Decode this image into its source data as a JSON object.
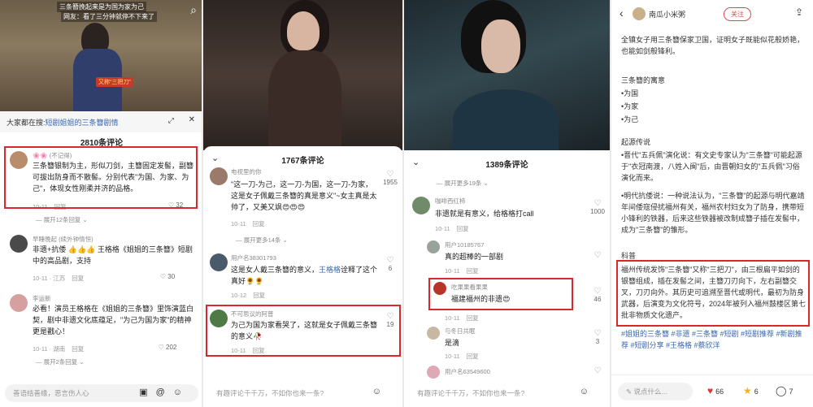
{
  "panel1": {
    "video_caption_top": "三条簪挽起来是为国为家为己",
    "video_caption_2": "网友：看了三分钟就停不下来了",
    "video_badge": "又称“三把刀”",
    "search_label": "大家都在搜:",
    "search_keyword": "短剧姐姐的三条簪剧情",
    "count": "2810条评论",
    "comments": [
      {
        "user": "🌸🌸 (不记得)",
        "text": "三条簪银制为主，形似刀剑，主簪固定发髻，副簪可拔出防身而不散髻。分别代表\"为国、为家、为己\"，体现女性刚柔并济的品格。",
        "meta": "10-11",
        "reply": "回复",
        "likes": "32"
      },
      {
        "expand": "展开12条回复"
      },
      {
        "user": "早睡晚起 (续外钟情恒)",
        "text_pre": "非遗+抗倭 👍👍👍 王格格《姐姐的三条簪》短剧中的高品剧，支持",
        "meta": "10-11 · 江苏",
        "reply": "回复",
        "likes": "30"
      },
      {
        "user": "李运新",
        "text": "必看！演员王格格在《姐姐的三条簪》里饰演蓝白契，剧中非遗文化底蕴足，\"为己为国为家\"的精神更是戳心！",
        "meta": "10-11 · 湖南",
        "reply": "回复",
        "likes": "202"
      },
      {
        "expand": "展开2条回复"
      }
    ],
    "input_placeholder": "善语结善缘，恶言伤人心"
  },
  "panel2": {
    "count": "1767条评论",
    "comments": [
      {
        "user": "电视里的你",
        "text": "\"这一刀-为己，这一刀-为国，这一刀-为家，这是女子佩戴三条簪的真是意义\"~女主真是太帅了，又美又飒😍😍😍",
        "meta": "10-11",
        "reply": "回复",
        "likes": "1955"
      },
      {
        "expand": "展开更多14条"
      },
      {
        "user": "用户名38301793",
        "text_pre": "这是女人戴三条簪的意义，",
        "mention": "王格格",
        "text_post": "诠释了这个真好🌻🌻",
        "meta": "10-12",
        "reply": "回复",
        "likes": "6"
      },
      {
        "user": "不可思议的阿普",
        "text": "为己为国为家看哭了，这就是女子佩戴三条簪的意义🥀",
        "meta": "10-11",
        "reply": "回复",
        "likes": "19"
      }
    ],
    "input_placeholder": "有趣评论千千万，不如你也来一条?"
  },
  "panel3": {
    "count": "1389条评论",
    "comments": [
      {
        "expand": "展开更多19条"
      },
      {
        "user": "咖啡西红柿",
        "text": "非遗就是有意义，给格格打call",
        "meta": "10-11",
        "reply": "回复",
        "likes": "1000"
      },
      {
        "user": "用户10185767",
        "text": "真的超棒的一部剧",
        "meta": "10-11",
        "reply": "回复",
        "likes": ""
      },
      {
        "user": "吃果果看果果",
        "text": "福建福州的非遗😍",
        "meta": "10-11",
        "reply": "回复",
        "likes": "46"
      },
      {
        "user": "与冬日共眠",
        "text": "是滴",
        "meta": "10-11",
        "reply": "回复",
        "likes": "3"
      },
      {
        "user": "用户名63549600",
        "text": "",
        "meta": "",
        "reply": "",
        "likes": ""
      }
    ],
    "input_placeholder": "有趣评论千千万，不如你也来一条?"
  },
  "panel4": {
    "author": "南瓜小米粥",
    "follow": "关注",
    "para1": "全镇女子用三条簪保家卫国，证明女子既能似花般娇艳，也能如剑般锋利。",
    "section1_title": "三条簪的寓意",
    "section1_items": [
      "•为国",
      "•为家",
      "•为己"
    ],
    "section2_title": "起源传说",
    "section2_p1": "•晋代\"五兵佩\"演化说：有文史专家认为\"三条簪\"可能起源于\"衣冠南渡，八姓入闽\"后，由晋朝妇女的\"五兵佩\"习俗演化而来。",
    "section2_p2": "•明代抗倭说：一种说法认为，\"三条簪\"的起源与明代嘉靖年间倭寇侵扰福州有关，福州农村妇女为了防身，携带短小锋利的铁器，后来这些铁器被改制成簪子插在发髻中，成为\"三条簪\"的雏形。",
    "section3_title": "科普",
    "section3_p": "福州传统发饰\"三条簪\"又称\"三把刀\"，由三根扁平如剑的银簪组成，插在发髻之间，主簪刀刃向下，左右副簪交叉，刀刃向外。其历史可追溯至晋代或明代，最初为防身武器，后演变为文化符号，2024年被列入福州鼓楼区第七批非物质文化遗产。",
    "tags": "#姐姐的三条簪 #非遗 #三条簪 #短剧 #短剧推荐 #新剧推荐 #短剧分享 #王格格 #蔡欣洋",
    "say_placeholder": "说点什么...",
    "likes": "66",
    "stars": "6",
    "comments": "7"
  }
}
